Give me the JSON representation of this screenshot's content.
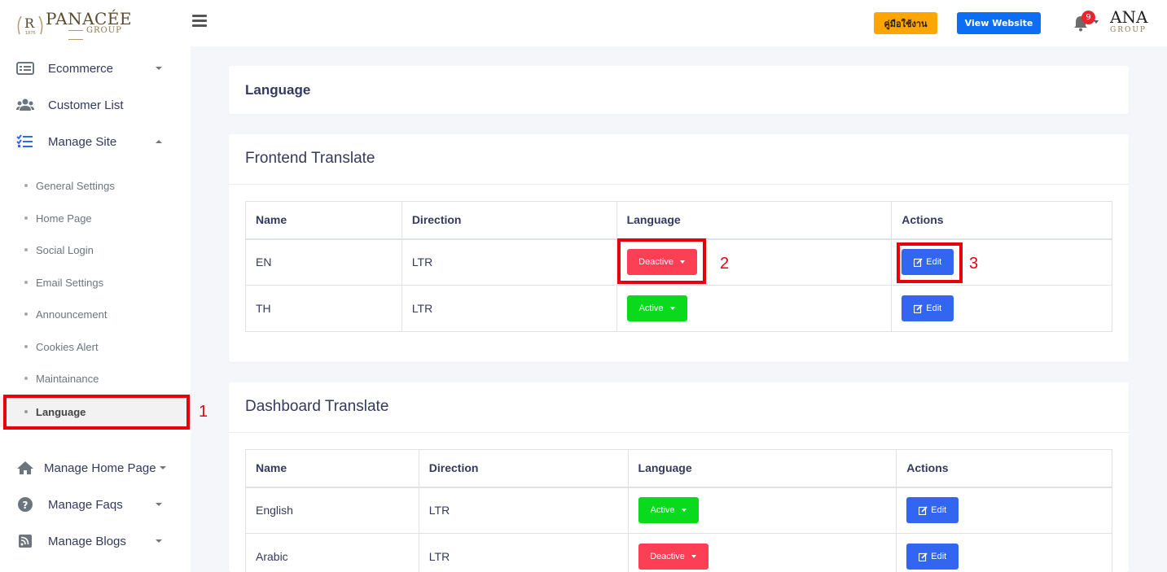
{
  "header": {
    "brand": "PANACÉE",
    "brand_sub": "GROUP",
    "manual_button": "คู่มือใช้งาน",
    "view_website_button": "View Website",
    "notification_count": "9",
    "user_logo_text": "ANA",
    "user_logo_sub": "GROUP"
  },
  "sidebar": {
    "items": [
      {
        "label": "Ecommerce",
        "icon": "list-alt-icon"
      },
      {
        "label": "Customer List",
        "icon": "users-icon"
      },
      {
        "label": "Manage Site",
        "icon": "tasks-icon"
      }
    ],
    "sub_items": [
      {
        "label": "General Settings"
      },
      {
        "label": "Home Page"
      },
      {
        "label": "Social Login"
      },
      {
        "label": "Email Settings"
      },
      {
        "label": "Announcement"
      },
      {
        "label": "Cookies Alert"
      },
      {
        "label": "Maintainance"
      },
      {
        "label": "Language"
      }
    ],
    "lower_items": [
      {
        "label": "Manage Home Page",
        "icon": "home-icon"
      },
      {
        "label": "Manage Faqs",
        "icon": "question-circle-icon"
      },
      {
        "label": "Manage Blogs",
        "icon": "rss-icon"
      }
    ]
  },
  "page": {
    "title": "Language"
  },
  "frontend": {
    "title": "Frontend Translate",
    "columns": [
      "Name",
      "Direction",
      "Language",
      "Actions"
    ],
    "rows": [
      {
        "name": "EN",
        "direction": "LTR",
        "status": "Deactive",
        "action": "Edit"
      },
      {
        "name": "TH",
        "direction": "LTR",
        "status": "Active",
        "action": "Edit"
      }
    ]
  },
  "dashboard": {
    "title": "Dashboard Translate",
    "columns": [
      "Name",
      "Direction",
      "Language",
      "Actions"
    ],
    "rows": [
      {
        "name": "English",
        "direction": "LTR",
        "status": "Active",
        "action": "Edit"
      },
      {
        "name": "Arabic",
        "direction": "LTR",
        "status": "Deactive",
        "action": "Edit"
      }
    ]
  },
  "annotations": [
    "1",
    "2",
    "3"
  ],
  "colors": {
    "accent_blue": "#3366f0",
    "active_green": "#0ada1e",
    "deactive_red": "#fc3f54",
    "manual_orange": "#ffa500",
    "annotation_red": "#e8000b"
  }
}
